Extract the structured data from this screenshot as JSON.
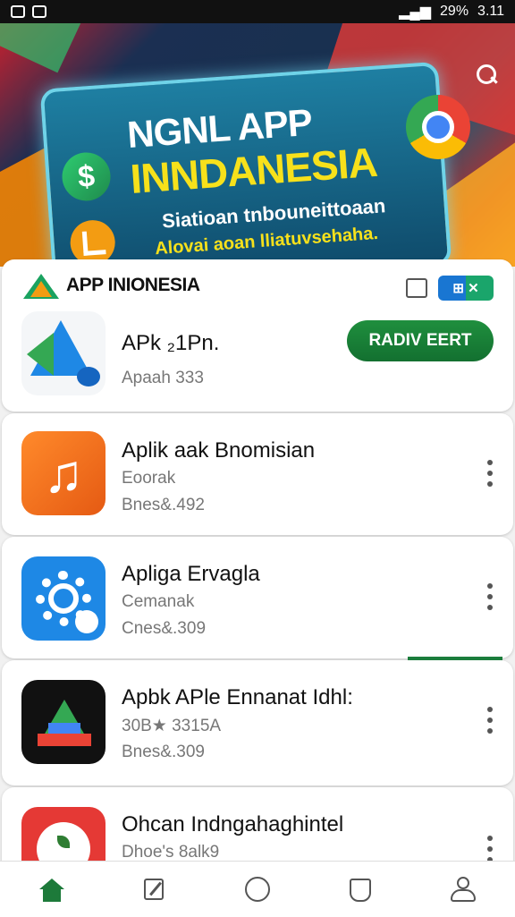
{
  "status_bar": {
    "battery": "29%",
    "time": "3.11"
  },
  "banner": {
    "title_line1": "NGNL APP",
    "title_line2": "INNDANESIA",
    "subtitle_line1": "Siatioan tnbouneittoaan",
    "subtitle_line2": "Alovai aoan lliatuvsehaha."
  },
  "header": {
    "title": "APP INIONESIA",
    "toggle_label": "⊞ ✕"
  },
  "apps": [
    {
      "name": "APk ₂1Pn.",
      "line1": "Apaah 333",
      "button": "RADIV EERT",
      "icon": "arrow-app-icon"
    },
    {
      "name": "Aplik aak Bnomisian",
      "line1": "Eoorak",
      "line2": "Bnes&.492",
      "icon": "music-app-icon"
    },
    {
      "name": "Apliga Ervagla",
      "line1": "Cemanak",
      "line2": "Cnes&.309",
      "icon": "gear-app-icon"
    },
    {
      "name": "Apbk APle Ennanat Idhl:",
      "line1": "30B★ 3315A",
      "line2": "Bnes&.309",
      "icon": "drive-app-icon"
    },
    {
      "name": "Ohcan Indngahaghintel",
      "line1": "Dhoe's 8alk9",
      "icon": "leaf-app-icon"
    }
  ],
  "colors": {
    "accent_green": "#1f8f3e",
    "header_blue": "#1976d2"
  },
  "nav": [
    "home-icon",
    "edit-icon",
    "circle-icon",
    "book-icon",
    "profile-icon"
  ]
}
